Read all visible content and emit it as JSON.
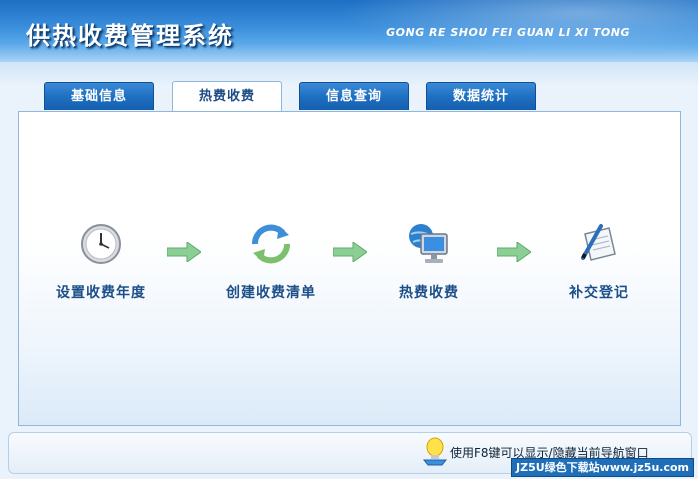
{
  "app": {
    "title": "供热收费管理系统",
    "pinyin": "GONG RE SHOU FEI GUAN LI XI TONG"
  },
  "tabs": [
    {
      "label": "基础信息",
      "active": false
    },
    {
      "label": "热费收费",
      "active": true
    },
    {
      "label": "信息查询",
      "active": false
    },
    {
      "label": "数据统计",
      "active": false
    }
  ],
  "steps": [
    {
      "label": "设置收费年度",
      "icon": "clock-icon"
    },
    {
      "label": "创建收费清单",
      "icon": "refresh-icon"
    },
    {
      "label": "热费收费",
      "icon": "computer-globe-icon"
    },
    {
      "label": "补交登记",
      "icon": "notepad-pen-icon"
    }
  ],
  "footer": {
    "hint": "使用F8键可以显示/隐藏当前导航窗口",
    "watermark": "JZ5U绿色下载站www.jz5u.com"
  },
  "colors": {
    "header_blue": "#1d6fc4",
    "tab_blue": "#1e6ec0",
    "label_blue": "#1c4f8a",
    "arrow_green": "#8ccf95"
  }
}
